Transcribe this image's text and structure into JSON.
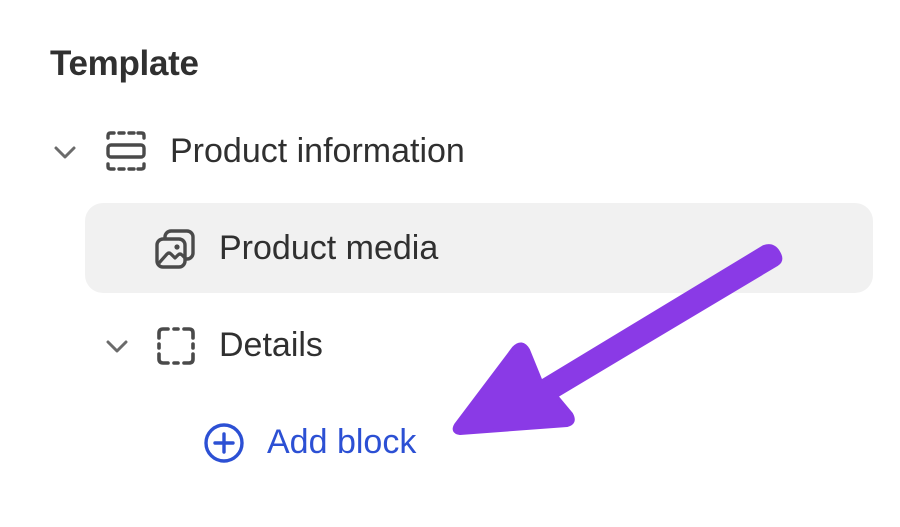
{
  "panel": {
    "title": "Template"
  },
  "tree": {
    "section": {
      "label": "Product information",
      "icon": "section-icon",
      "expanded": true
    },
    "blocks": [
      {
        "label": "Product media",
        "icon": "media-gallery-icon",
        "selected": true
      },
      {
        "label": "Details",
        "icon": "block-frame-icon",
        "expanded": true
      }
    ],
    "add_block": {
      "label": "Add block",
      "icon": "plus-circle-icon"
    }
  },
  "colors": {
    "text": "#303030",
    "link": "#2c50d4",
    "selected_bg": "#f1f1f1",
    "annotation_arrow": "#8a3ae6"
  }
}
